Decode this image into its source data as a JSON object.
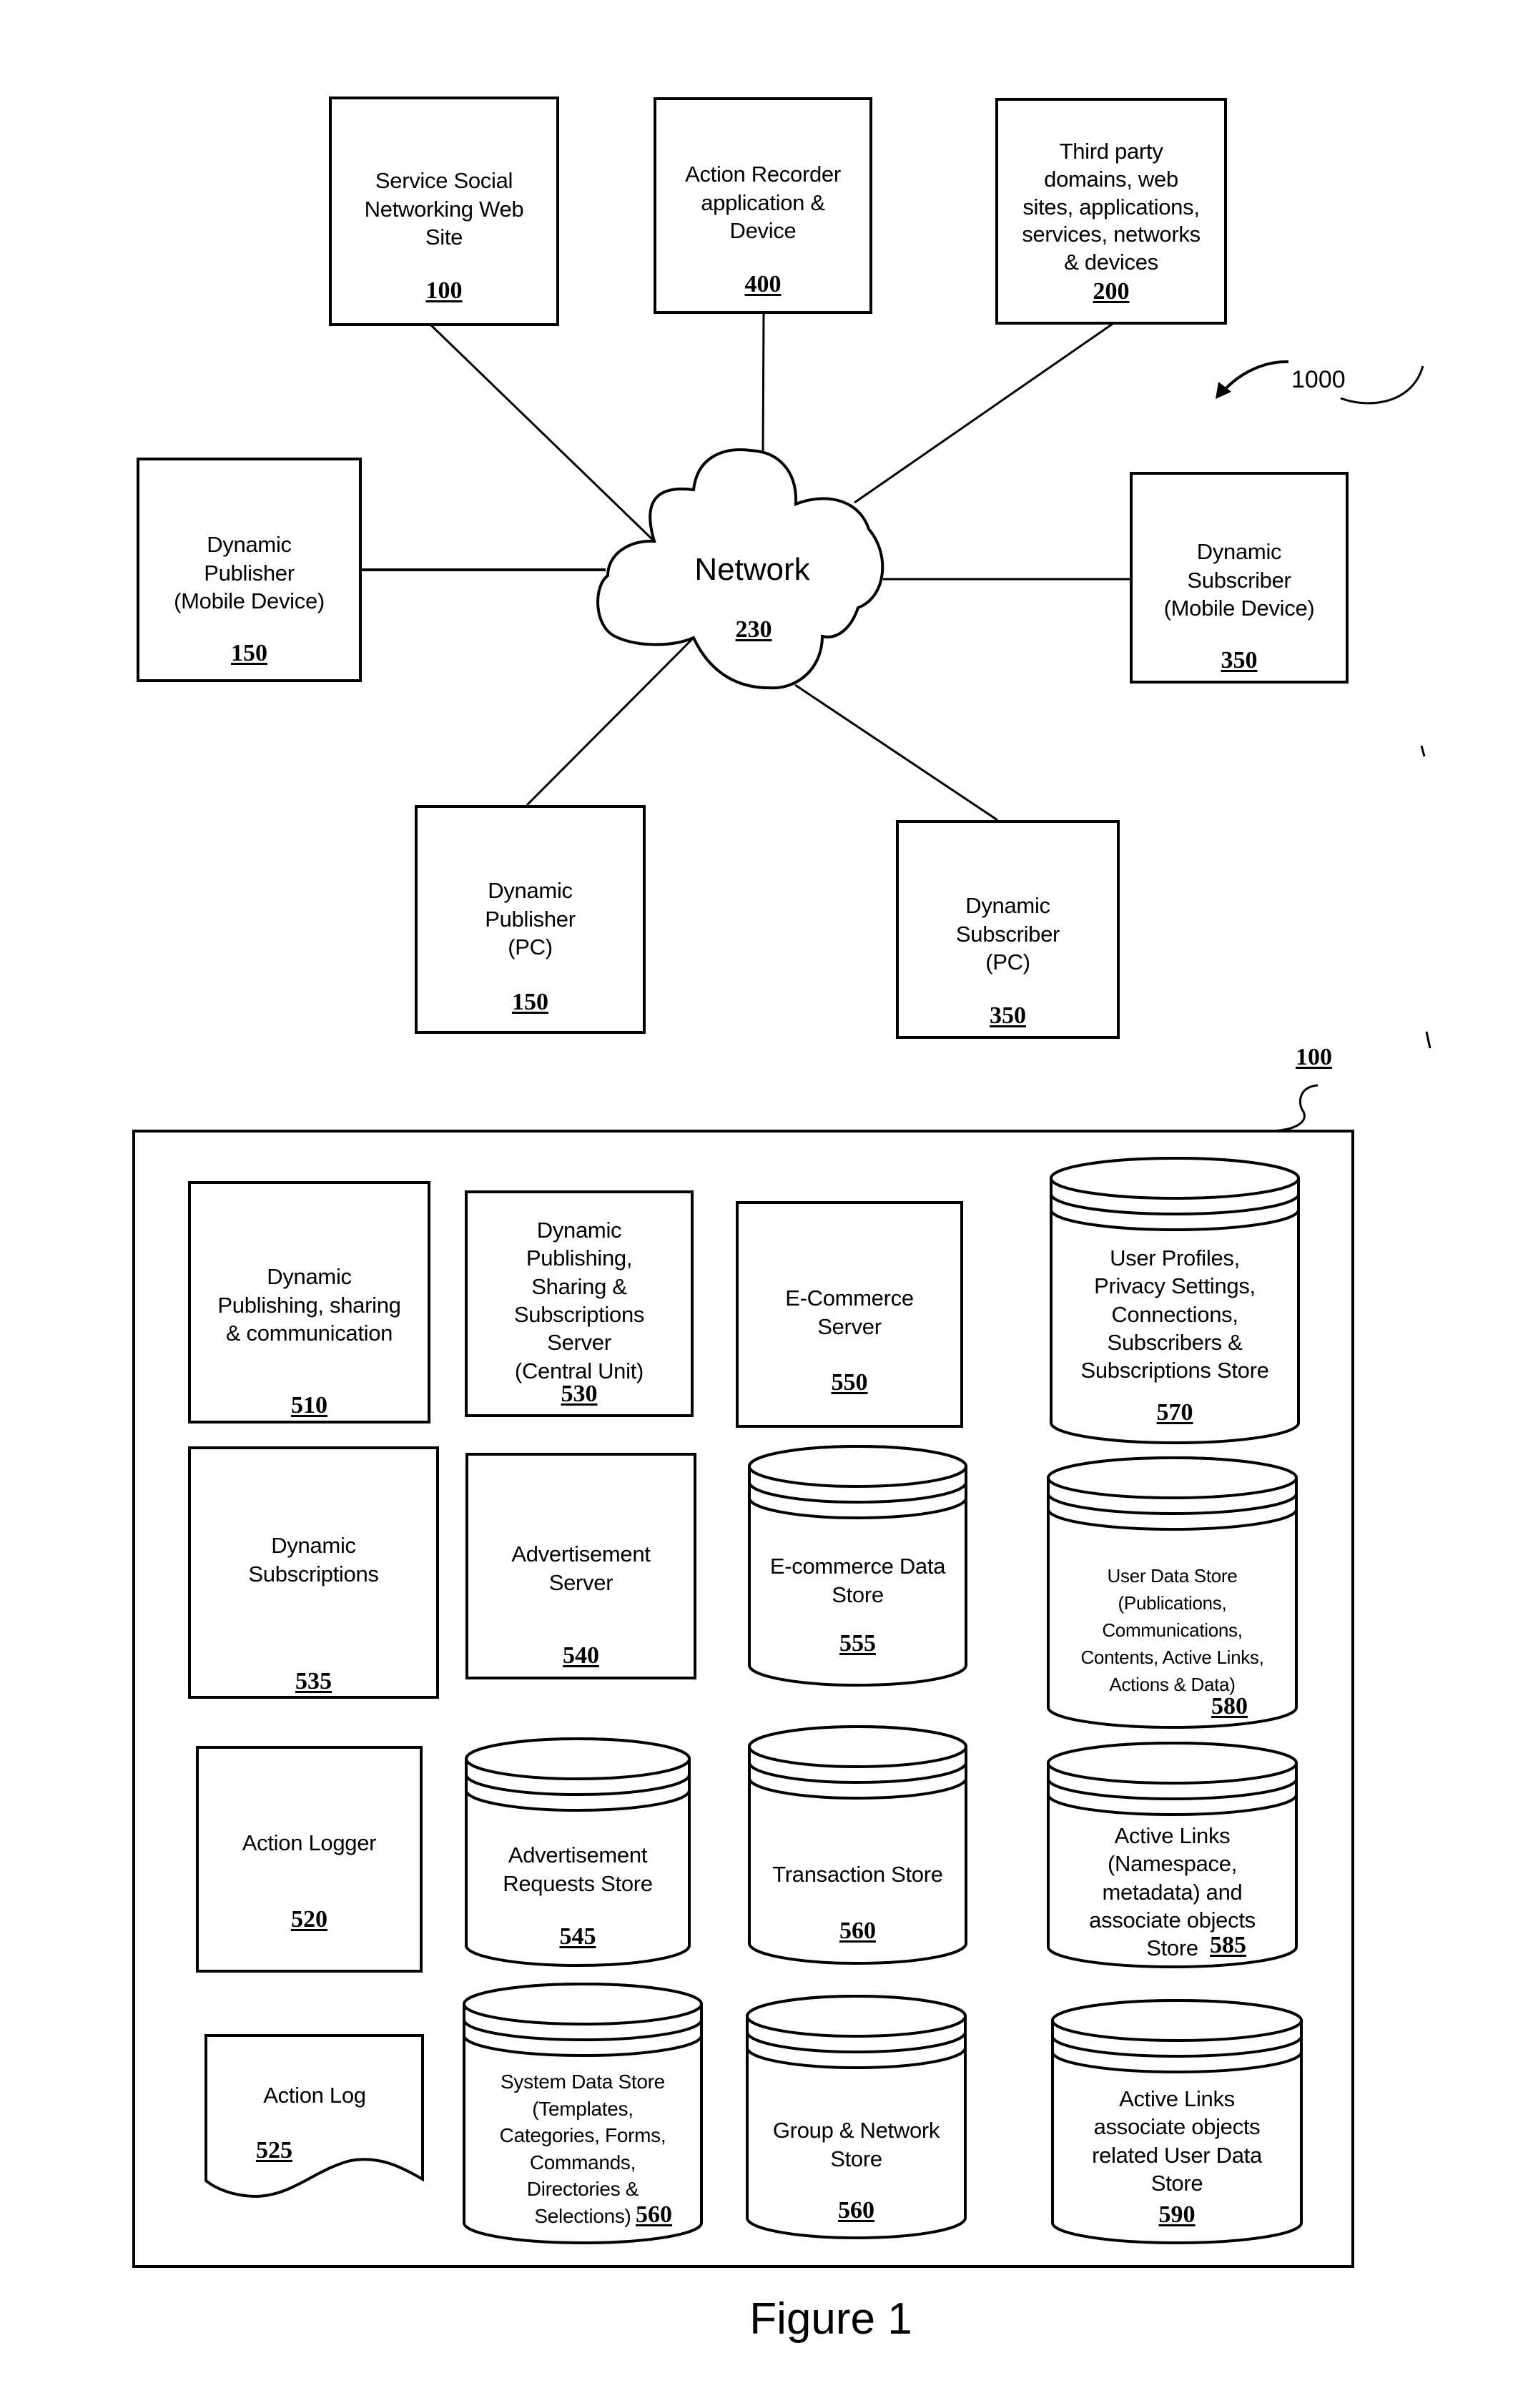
{
  "figure": {
    "caption": "Figure 1",
    "system_ref": "1000",
    "site_ref": "100"
  },
  "network": {
    "hub": {
      "label": "Network",
      "ref": "230"
    },
    "nodes": [
      {
        "id": "service-social-networking-site",
        "label": "Service Social\nNetworking Web\nSite",
        "ref": "100"
      },
      {
        "id": "action-recorder",
        "label": "Action Recorder\napplication &\nDevice",
        "ref": "400"
      },
      {
        "id": "third-party",
        "label": "Third party\ndomains, web\nsites, applications,\nservices, networks\n& devices",
        "ref": "200"
      },
      {
        "id": "dynamic-publisher-mobile",
        "label": "Dynamic\nPublisher\n(Mobile Device)",
        "ref": "150"
      },
      {
        "id": "dynamic-subscriber-mobile",
        "label": "Dynamic\nSubscriber\n(Mobile Device)",
        "ref": "350"
      },
      {
        "id": "dynamic-publisher-pc",
        "label": "Dynamic\nPublisher\n(PC)",
        "ref": "150"
      },
      {
        "id": "dynamic-subscriber-pc",
        "label": "Dynamic\nSubscriber\n(PC)",
        "ref": "350"
      }
    ]
  },
  "components": [
    {
      "id": "dynamic-publishing-sharing-communication",
      "shape": "box",
      "label": "Dynamic\nPublishing, sharing\n& communication",
      "ref": "510"
    },
    {
      "id": "dynamic-publishing-server",
      "shape": "box",
      "label": "Dynamic\nPublishing,\nSharing &\nSubscriptions\nServer\n(Central Unit)",
      "ref": "530"
    },
    {
      "id": "ecommerce-server",
      "shape": "box",
      "label": "E-Commerce\nServer",
      "ref": "550"
    },
    {
      "id": "user-profiles-store",
      "shape": "cylinder",
      "label": "User Profiles,\nPrivacy Settings,\nConnections,\nSubscribers &\nSubscriptions Store",
      "ref": "570"
    },
    {
      "id": "dynamic-subscriptions",
      "shape": "box",
      "label": "Dynamic\nSubscriptions",
      "ref": "535"
    },
    {
      "id": "advertisement-server",
      "shape": "box",
      "label": "Advertisement\nServer",
      "ref": "540"
    },
    {
      "id": "ecommerce-data-store",
      "shape": "cylinder",
      "label": "E-commerce Data\nStore",
      "ref": "555"
    },
    {
      "id": "user-data-store",
      "shape": "cylinder",
      "label": "User Data Store\n(Publications,\nCommunications,\nContents, Active Links,\nActions & Data)",
      "ref": "580"
    },
    {
      "id": "action-logger",
      "shape": "box",
      "label": "Action Logger",
      "ref": "520"
    },
    {
      "id": "advertisement-requests-store",
      "shape": "cylinder",
      "label": "Advertisement\nRequests Store",
      "ref": "545"
    },
    {
      "id": "transaction-store",
      "shape": "cylinder",
      "label": "Transaction Store",
      "ref": "560"
    },
    {
      "id": "active-links-namespace-store",
      "shape": "cylinder",
      "label": "Active Links\n(Namespace,\nmetadata) and\nassociate objects\nStore",
      "ref": "585"
    },
    {
      "id": "action-log",
      "shape": "document",
      "label": "Action Log",
      "ref": "525"
    },
    {
      "id": "system-data-store",
      "shape": "cylinder",
      "label": "System Data Store\n(Templates,\nCategories, Forms,\nCommands,\nDirectories &\nSelections)",
      "ref": "560"
    },
    {
      "id": "group-network-store",
      "shape": "cylinder",
      "label": "Group & Network\nStore",
      "ref": "560"
    },
    {
      "id": "active-links-user-data-store",
      "shape": "cylinder",
      "label": "Active Links\nassociate objects\nrelated User Data\nStore",
      "ref": "590"
    }
  ]
}
